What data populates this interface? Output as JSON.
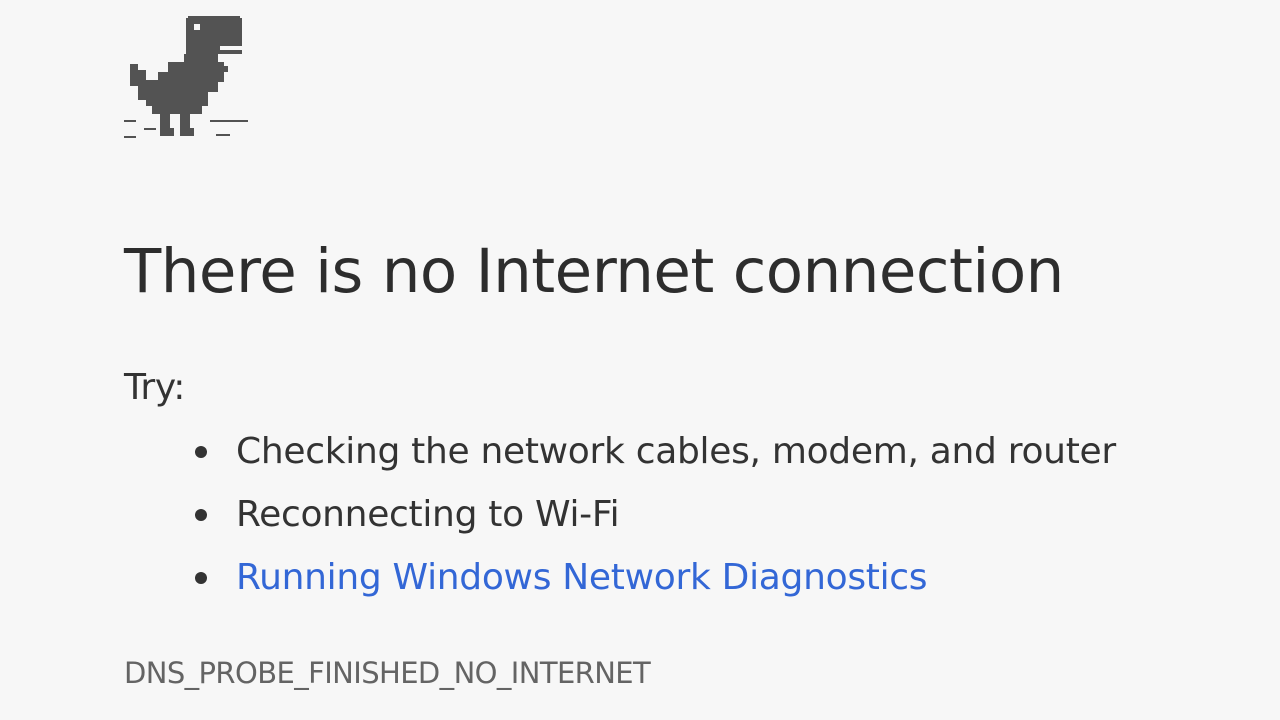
{
  "icon": "offline-dinosaur-icon",
  "headline": "There is no Internet connection",
  "try_label": "Try:",
  "suggestions": [
    {
      "text": "Checking the network cables, modem, and router",
      "is_link": false
    },
    {
      "text": "Reconnecting to Wi-Fi",
      "is_link": false
    },
    {
      "text": "Running Windows Network Diagnostics",
      "is_link": true
    }
  ],
  "error_code": "DNS_PROBE_FINISHED_NO_INTERNET",
  "colors": {
    "background": "#f7f7f7",
    "text": "#333333",
    "link": "#3367d6",
    "error_code": "#646464",
    "dino": "#535353"
  }
}
